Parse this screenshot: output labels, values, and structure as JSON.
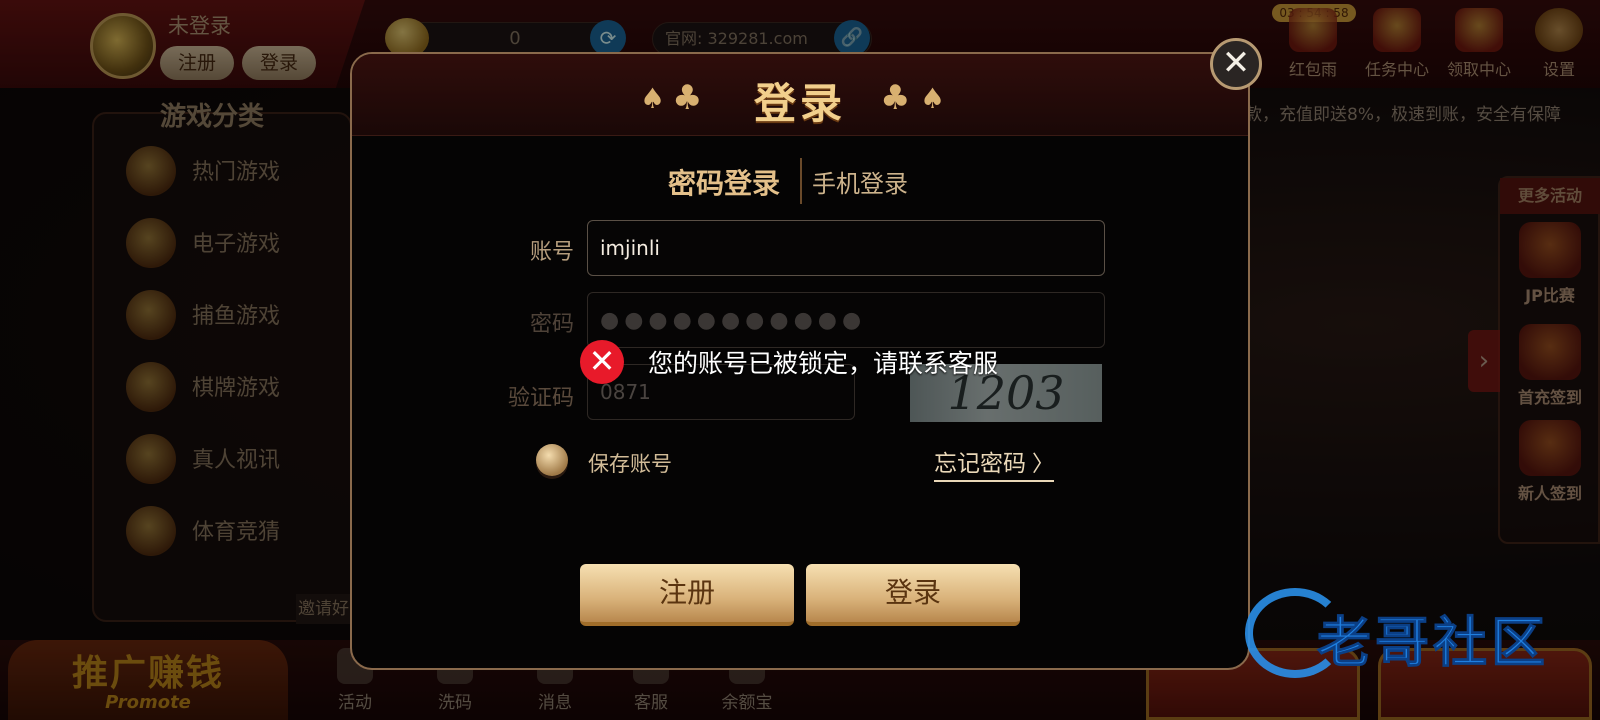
{
  "header": {
    "login_status": "未登录",
    "register_label": "注册",
    "login_label": "登录",
    "balance": "0",
    "site_url": "官网: 329281.com",
    "timer": "03 : 54 : 58",
    "actions": [
      {
        "label": "红包雨",
        "icon": "red-envelope-icon"
      },
      {
        "label": "任务中心",
        "icon": "task-center-icon"
      },
      {
        "label": "领取中心",
        "icon": "claim-center-icon"
      },
      {
        "label": "设置",
        "icon": "gear-icon"
      }
    ],
    "marquee": "款，充值即送8%，极速到账，安全有保障"
  },
  "sidebar": {
    "title": "游戏分类",
    "items": [
      {
        "label": "热门游戏"
      },
      {
        "label": "电子游戏"
      },
      {
        "label": "捕鱼游戏"
      },
      {
        "label": "棋牌游戏"
      },
      {
        "label": "真人视讯"
      },
      {
        "label": "体育竞猜"
      }
    ],
    "invite_label": "邀请好"
  },
  "right_panel": {
    "title": "更多活动",
    "items": [
      {
        "label": "JP比赛"
      },
      {
        "label": "首充签到"
      },
      {
        "label": "新人签到"
      }
    ]
  },
  "bottom": {
    "promote_cn": "推广赚钱",
    "promote_en": "Promote",
    "nav": [
      {
        "label": "活动"
      },
      {
        "label": "洗码"
      },
      {
        "label": "消息"
      },
      {
        "label": "客服"
      },
      {
        "label": "余额宝"
      }
    ]
  },
  "watermark": {
    "text": "老哥社区"
  },
  "login_modal": {
    "title": "登录",
    "tabs": {
      "password_login": "密码登录",
      "phone_login": "手机登录"
    },
    "account": {
      "label": "账号",
      "value": "imjinli"
    },
    "password": {
      "label": "密码",
      "value": "●●●●●●●●●●●"
    },
    "captcha": {
      "label": "验证码",
      "value": "0871",
      "image_text": "1203"
    },
    "remember_label": "保存账号",
    "forgot_label": "忘记密码",
    "register_button": "注册",
    "login_button": "登录"
  },
  "toast": {
    "message": "您的账号已被锁定，请联系客服"
  },
  "colors": {
    "accent_gold": "#f2cf8c",
    "error_red": "#e81a2a",
    "button_gold": "#d9b27a"
  }
}
